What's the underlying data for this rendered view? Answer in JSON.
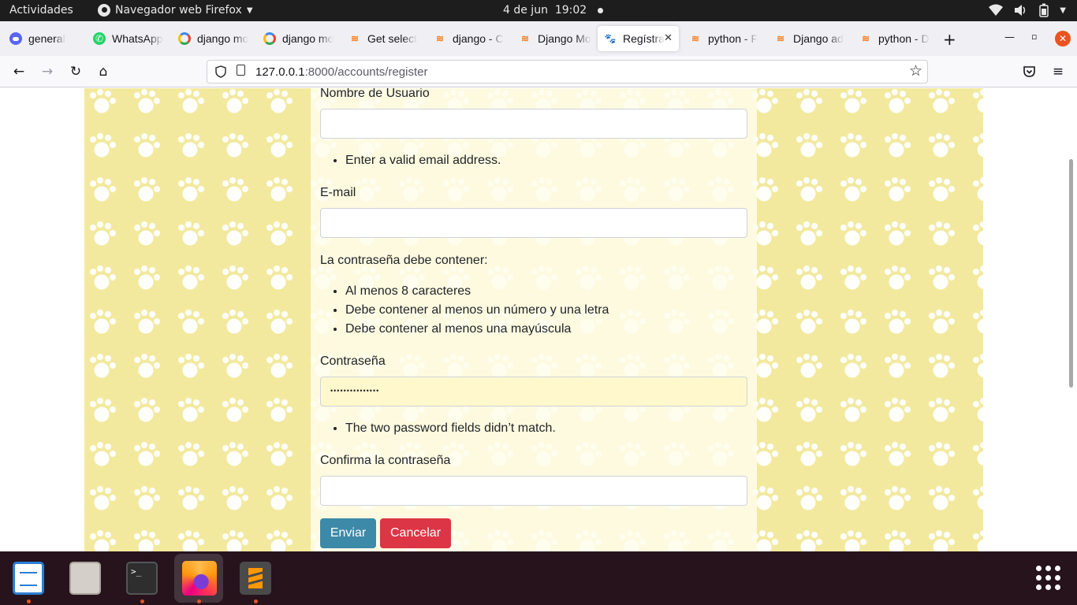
{
  "topbar": {
    "activities": "Actividades",
    "app_name": "Navegador web Firefox",
    "date": "4 de jun",
    "time": "19:02"
  },
  "tabs": [
    {
      "title": "general",
      "icon": "discord-icon",
      "active": false
    },
    {
      "title": "WhatsApp",
      "icon": "whatsapp-icon",
      "active": false
    },
    {
      "title": "django mo",
      "icon": "google-icon",
      "active": false
    },
    {
      "title": "django mo",
      "icon": "google-icon",
      "active": false
    },
    {
      "title": "Get select",
      "icon": "stackoverflow-icon",
      "active": false
    },
    {
      "title": "django - C",
      "icon": "stackoverflow-icon",
      "active": false
    },
    {
      "title": "Django Mo",
      "icon": "stackoverflow-icon",
      "active": false
    },
    {
      "title": "Regístra",
      "icon": "paw-icon",
      "active": true
    },
    {
      "title": "python - F",
      "icon": "stackoverflow-icon",
      "active": false
    },
    {
      "title": "Django ad",
      "icon": "stackoverflow-icon",
      "active": false
    },
    {
      "title": "python - D",
      "icon": "stackoverflow-icon",
      "active": false
    }
  ],
  "urlbar": {
    "host": "127.0.0.1",
    "path": ":8000/accounts/register"
  },
  "form": {
    "username_label": "Nombre de Usuario",
    "username_value": "",
    "email_error": "Enter a valid email address.",
    "email_label": "E-mail",
    "email_value": "",
    "password_help_title": "La contraseña debe contener:",
    "password_rules": [
      "Al menos 8 caracteres",
      "Debe contener al menos un número y una letra",
      "Debe contener al menos una mayúscula"
    ],
    "password_label": "Contraseña",
    "password_value": "•••••••••••••••",
    "password_error": "The two password fields didn’t match.",
    "confirm_label": "Confirma la contraseña",
    "confirm_value": "",
    "submit_label": "Enviar",
    "cancel_label": "Cancelar"
  },
  "dock": {
    "items": [
      "libreoffice-writer",
      "files",
      "terminal",
      "firefox",
      "sublime-text"
    ],
    "terminal_prompt": ">_"
  },
  "colors": {
    "background_yellow": "#f2e99e",
    "submit_button": "#3c8aa8",
    "cancel_button": "#dc3545",
    "dock": "#26131c",
    "autofill": "#fff8cc"
  }
}
